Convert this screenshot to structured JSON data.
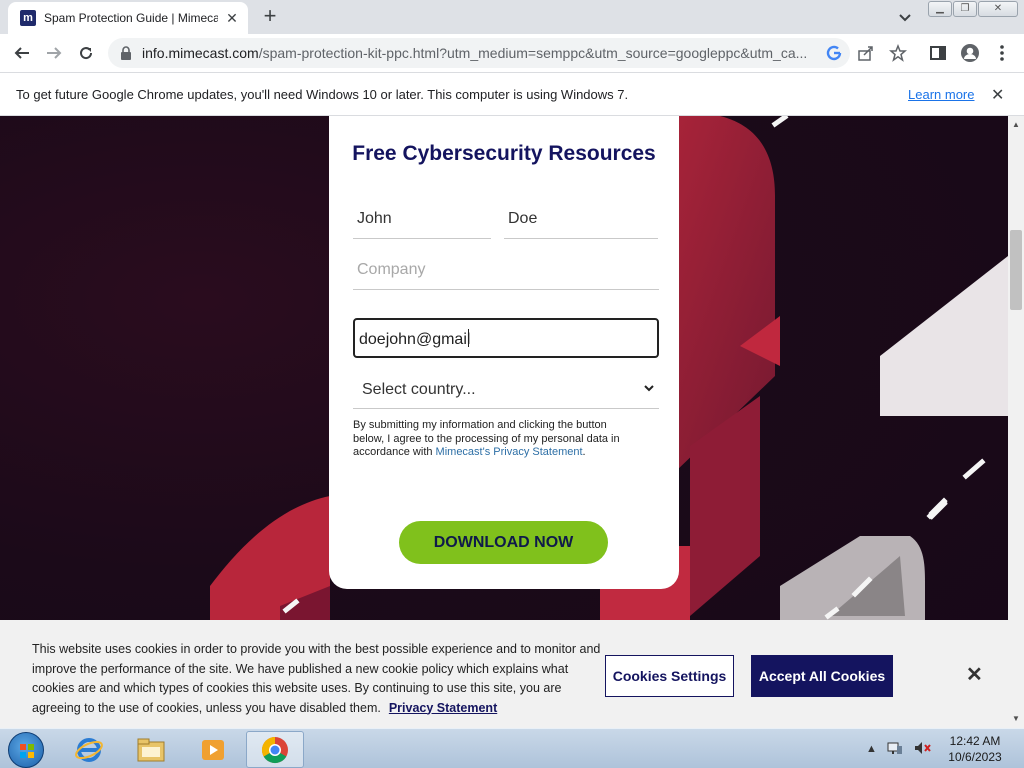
{
  "browser": {
    "tab_title": "Spam Protection Guide | Mimecast",
    "favicon_letter": "m",
    "new_tab": "+",
    "url_host": "info.mimecast.com",
    "url_path": "/spam-protection-kit-ppc.html?utm_medium=semppc&utm_source=googleppc&utm_ca..."
  },
  "infobar": {
    "message": "To get future Google Chrome updates, you'll need Windows 10 or later. This computer is using Windows 7.",
    "link": "Learn more"
  },
  "form": {
    "title": "Free Cybersecurity Resources",
    "first_name": "John",
    "last_name": "Doe",
    "company_placeholder": "Company",
    "email_value": "doejohn@gmail",
    "country_placeholder": "Select country...",
    "consent_text": "By submitting my information and clicking the button below, I agree to the processing of my personal data in accordance with ",
    "consent_link": "Mimecast's Privacy Statement",
    "consent_end": ".",
    "submit_label": "DOWNLOAD NOW"
  },
  "cookie": {
    "text": "This website uses cookies in order to provide you with the best possible experience and to monitor and improve the performance of the site. We have published a new cookie policy which explains what cookies are and which types of cookies this website uses. By continuing to use this site, you are agreeing to the use of cookies, unless you have disabled them.",
    "privacy_link": "Privacy Statement",
    "settings_label": "Cookies Settings",
    "accept_label": "Accept All Cookies"
  },
  "taskbar": {
    "time": "12:42 AM",
    "date": "10/6/2023"
  },
  "colors": {
    "brand_navy": "#14145f",
    "download_green": "#80c11c",
    "background": "#170817",
    "accent_red": "#b8263b"
  }
}
